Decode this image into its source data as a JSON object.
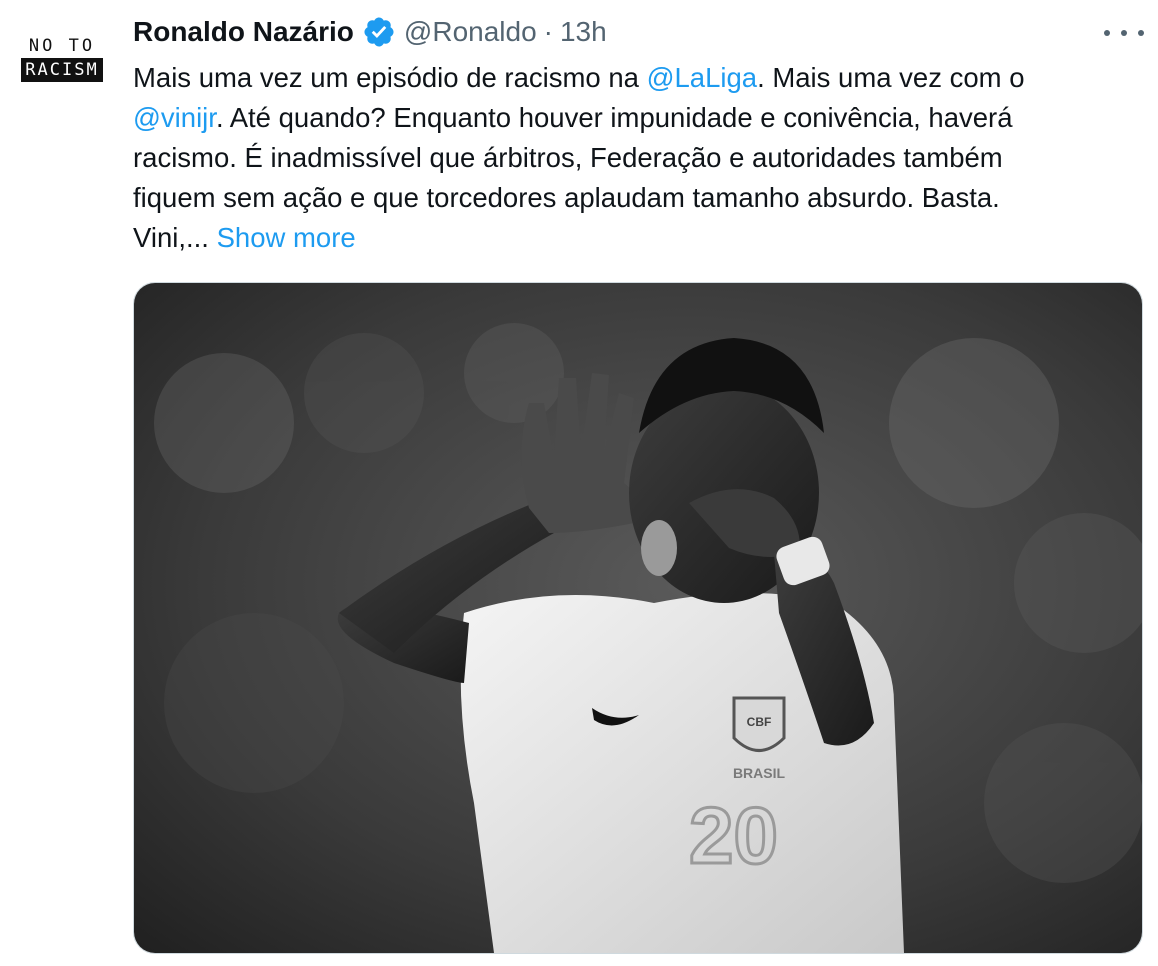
{
  "avatar": {
    "line1": "NO TO",
    "line2": "RACISM"
  },
  "author": {
    "display_name": "Ronaldo Nazário",
    "handle": "@Ronaldo",
    "separator": "·",
    "time": "13h",
    "verified_icon": "verified-badge-icon"
  },
  "tweet": {
    "line1_a": "Mais uma vez um episódio de racismo na ",
    "mention1": "@LaLiga",
    "line1_b": ". Mais uma vez com o",
    "mention2": "@vinijr",
    "line2_b": ". Até quando? Enquanto houver impunidade e conivência, haverá",
    "line3": "racismo. É inadmissível que árbitros, Federação e autoridades também",
    "line4": "fiquem sem ação e que torcedores aplaudam tamanho absurdo. Basta.",
    "line5_a": "Vini,... ",
    "show_more": "Show more"
  },
  "media": {
    "badge_text": "CBF",
    "shirt_text": "BRASIL",
    "shirt_number": "20"
  },
  "colors": {
    "link": "#1d9bf0",
    "secondary_text": "#536471",
    "primary_text": "#0f1419",
    "verified": "#1d9bf0"
  }
}
